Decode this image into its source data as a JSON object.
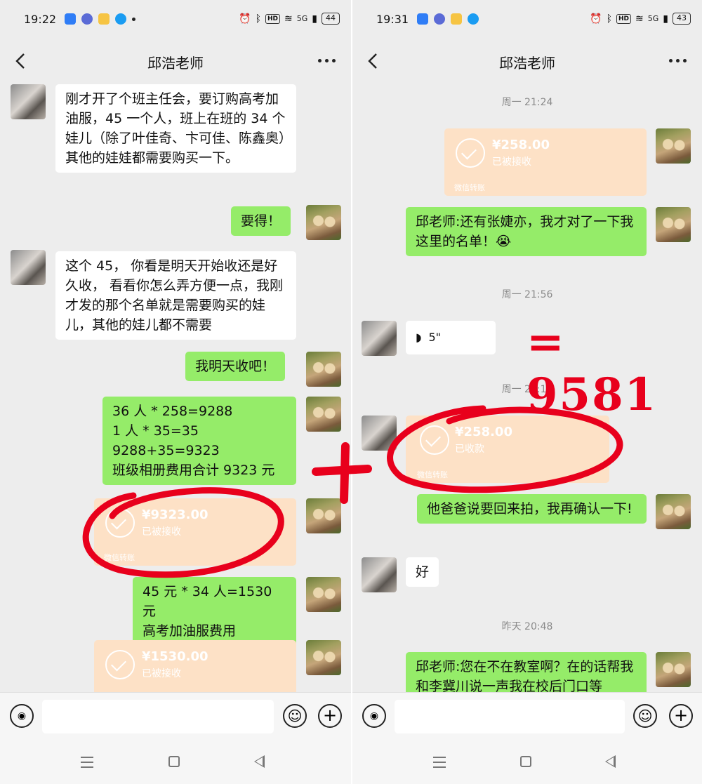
{
  "left": {
    "status": {
      "time": "19:22",
      "network": "5G",
      "battery": "44",
      "hd": "HD"
    },
    "title": "邱浩老师",
    "messages": [
      {
        "side": "in",
        "type": "text",
        "text": "刚才开了个班主任会，要订购高考加油服，45 一个人，班上在班的 34 个娃儿（除了叶佳奇、卞可佳、陈鑫奥）其他的娃娃都需要购买一下。"
      },
      {
        "side": "out",
        "type": "text",
        "text": "要得！"
      },
      {
        "side": "in",
        "type": "text",
        "text": "这个 45， 你看是明天开始收还是好久收， 看看你怎么弄方便一点，我刚才发的那个名单就是需要购买的娃儿，其他的娃儿都不需要"
      },
      {
        "side": "out",
        "type": "text",
        "text": "我明天收吧！"
      },
      {
        "side": "out",
        "type": "text",
        "lines": [
          "36 人 * 258=9288",
          "1 人 * 35=35",
          "9288+35=9323",
          "班级相册费用合计 9323 元"
        ]
      },
      {
        "side": "out",
        "type": "transfer",
        "amount": "¥9323.00",
        "status": "已被接收",
        "footer": "微信转账"
      },
      {
        "side": "out",
        "type": "text",
        "lines": [
          "45 元 * 34 人=1530 元",
          "高考加油服费用"
        ]
      },
      {
        "side": "out",
        "type": "transfer",
        "amount": "¥1530.00",
        "status": "已被接收"
      }
    ]
  },
  "right": {
    "status": {
      "time": "19:31",
      "network": "5G",
      "battery": "43",
      "hd": "HD"
    },
    "title": "邱浩老师",
    "messages": [
      {
        "type": "time",
        "text": "周一 21:24"
      },
      {
        "side": "out",
        "type": "transfer",
        "amount": "¥258.00",
        "status": "已被接收",
        "footer": "微信转账"
      },
      {
        "side": "out",
        "type": "text",
        "text": "邱老师:还有张婕亦，我才对了一下我这里的名单！😭"
      },
      {
        "type": "time",
        "text": "周一 21:56"
      },
      {
        "side": "in",
        "type": "voice",
        "duration": "5\""
      },
      {
        "type": "time",
        "text": "周一 22:14"
      },
      {
        "side": "in",
        "type": "transfer",
        "amount": "¥258.00",
        "status": "已收款",
        "footer": "微信转账"
      },
      {
        "side": "out",
        "type": "text",
        "text": "他爸爸说要回来拍，我再确认一下!"
      },
      {
        "side": "in",
        "type": "text",
        "text": "好"
      },
      {
        "type": "time",
        "text": "昨天 20:48"
      },
      {
        "side": "out",
        "type": "text",
        "text": "邱老师:您在不在教室啊？在的话帮我和李冀川说一声我在校后门口等"
      }
    ]
  },
  "annotations": {
    "equals_text": "= 9581",
    "plus": "+",
    "color": "#e8001c"
  },
  "icons": {
    "back": "chevron-left-icon",
    "more": "more-dots-icon",
    "voice": "voice-input-icon",
    "emoji": "emoji-icon",
    "plus": "plus-icon",
    "check": "check-circle-icon",
    "nav_menu": "nav-menu-icon",
    "nav_home": "nav-home-icon",
    "nav_back": "nav-back-icon"
  },
  "colors": {
    "chat_bg": "#ededed",
    "bubble_out": "#95ec69",
    "bubble_in": "#ffffff",
    "transfer": "#fde1c6"
  }
}
